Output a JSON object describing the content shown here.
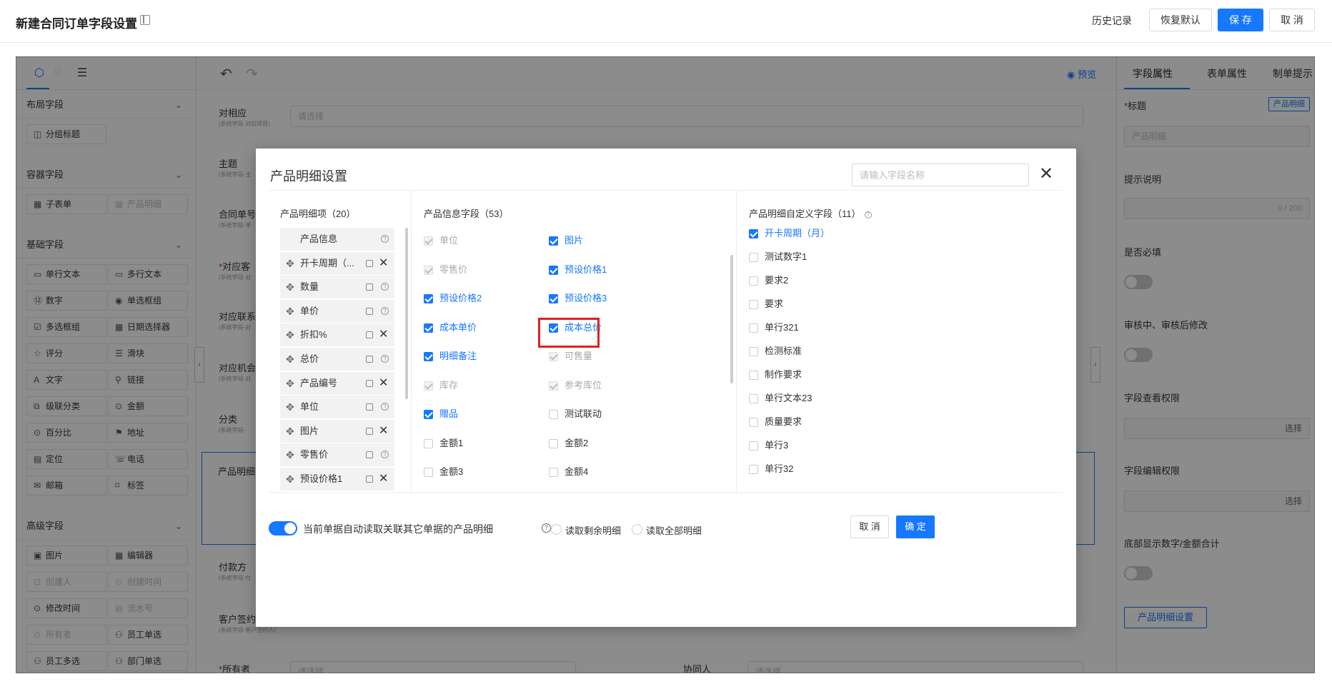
{
  "header": {
    "title": "新建合同订单字段设置",
    "history": "历史记录",
    "restore": "恢复默认",
    "save": "保 存",
    "cancel": "取 消"
  },
  "left_panel": {
    "layout_section": "布局字段",
    "layout_items": [
      "分组标题"
    ],
    "container_section": "容器字段",
    "container_items": [
      "子表单",
      "产品明细"
    ],
    "basic_section": "基础字段",
    "basic_items": [
      "单行文本",
      "多行文本",
      "数字",
      "单选框组",
      "多选框组",
      "日期选择器",
      "评分",
      "滑块",
      "文字",
      "链接",
      "级联分类",
      "金额",
      "百分比",
      "地址",
      "定位",
      "电话",
      "邮箱",
      "标签"
    ],
    "advanced_section": "高级字段",
    "advanced_items": [
      "图片",
      "编辑器",
      "创建人",
      "创建时间",
      "修改时间",
      "流水号",
      "所有者",
      "员工单选",
      "员工多选",
      "部门单选"
    ]
  },
  "canvas": {
    "preview": "预览",
    "fields": [
      {
        "label": "对相应",
        "sub": "(系统字段-对应项目)",
        "placeholder": "请选择"
      },
      {
        "label": "主题",
        "sub": "(系统字段-主"
      },
      {
        "label": "合同单号",
        "sub": "(系统字段-单"
      },
      {
        "label": "对应客",
        "sub": "(系统字段-对"
      },
      {
        "label": "对应联系",
        "sub": "(系统字段-对"
      },
      {
        "label": "对应机会",
        "sub": "(系统字段-对"
      },
      {
        "label": "分类",
        "sub": "(系统字段-"
      },
      {
        "label": "产品明细"
      },
      {
        "label": "付款方",
        "sub": "(系统字段-付"
      },
      {
        "label": "客户签约",
        "sub": "(系统字段-客户签约人)"
      },
      {
        "label": "所有者",
        "placeholder": "请选择"
      },
      {
        "label": "协同人",
        "placeholder": "请选择"
      }
    ]
  },
  "right_panel": {
    "tabs": [
      "字段属性",
      "表单属性",
      "制单提示"
    ],
    "title_label": "标题",
    "title_badge": "产品明细",
    "title_value": "产品明细",
    "hint_label": "提示说明",
    "hint_counter": "0 / 200",
    "required_label": "是否必填",
    "edit_label": "审核中、审核后修改",
    "view_perm_label": "字段查看权限",
    "edit_perm_label": "字段编辑权限",
    "select": "选择",
    "bottom_sum_label": "底部显示数字/金额合计",
    "product_settings_btn": "产品明细设置"
  },
  "modal": {
    "title": "产品明细设置",
    "search_placeholder": "请输入字段名称",
    "col1_title": "产品明细项（20）",
    "col1_items": [
      {
        "name": "产品信息",
        "action": "help"
      },
      {
        "name": "开卡周期（...",
        "action": "remove"
      },
      {
        "name": "数量",
        "action": "help"
      },
      {
        "name": "单价",
        "action": "help"
      },
      {
        "name": "折扣%",
        "action": "remove"
      },
      {
        "name": "总价",
        "action": "help"
      },
      {
        "name": "产品编号",
        "action": "remove"
      },
      {
        "name": "单位",
        "action": "help"
      },
      {
        "name": "图片",
        "action": "remove"
      },
      {
        "name": "零售价",
        "action": "help"
      },
      {
        "name": "预设价格1",
        "action": "remove"
      }
    ],
    "col2_title": "产品信息字段（53）",
    "col2_items": [
      {
        "label": "单位",
        "state": "disabled"
      },
      {
        "label": "图片",
        "state": "checked"
      },
      {
        "label": "零售价",
        "state": "disabled"
      },
      {
        "label": "预设价格1",
        "state": "checked"
      },
      {
        "label": "预设价格2",
        "state": "checked"
      },
      {
        "label": "预设价格3",
        "state": "checked"
      },
      {
        "label": "成本单价",
        "state": "checked"
      },
      {
        "label": "成本总价",
        "state": "checked"
      },
      {
        "label": "明细备注",
        "state": "checked"
      },
      {
        "label": "可售量",
        "state": "disabled"
      },
      {
        "label": "库存",
        "state": "disabled"
      },
      {
        "label": "参考库位",
        "state": "disabled"
      },
      {
        "label": "赠品",
        "state": "checked"
      },
      {
        "label": "测试联动",
        "state": "unchecked"
      },
      {
        "label": "金额1",
        "state": "unchecked"
      },
      {
        "label": "金额2",
        "state": "unchecked"
      },
      {
        "label": "金额3",
        "state": "unchecked"
      },
      {
        "label": "金额4",
        "state": "unchecked"
      }
    ],
    "col3_title": "产品明细自定义字段（11）",
    "col3_items": [
      {
        "label": "开卡周期（月）",
        "state": "checked"
      },
      {
        "label": "测试数字1",
        "state": "unchecked"
      },
      {
        "label": "要求2",
        "state": "unchecked"
      },
      {
        "label": "要求",
        "state": "unchecked"
      },
      {
        "label": "单行321",
        "state": "unchecked"
      },
      {
        "label": "检测标准",
        "state": "unchecked"
      },
      {
        "label": "制作要求",
        "state": "unchecked"
      },
      {
        "label": "单行文本23",
        "state": "unchecked"
      },
      {
        "label": "质量要求",
        "state": "unchecked"
      },
      {
        "label": "单行3",
        "state": "unchecked"
      },
      {
        "label": "单行32",
        "state": "unchecked"
      }
    ],
    "footer": {
      "auto_read_label": "当前单据自动读取关联其它单据的产品明细",
      "radio_remaining": "读取剩余明细",
      "radio_all": "读取全部明细",
      "cancel": "取 消",
      "confirm": "确 定"
    }
  }
}
